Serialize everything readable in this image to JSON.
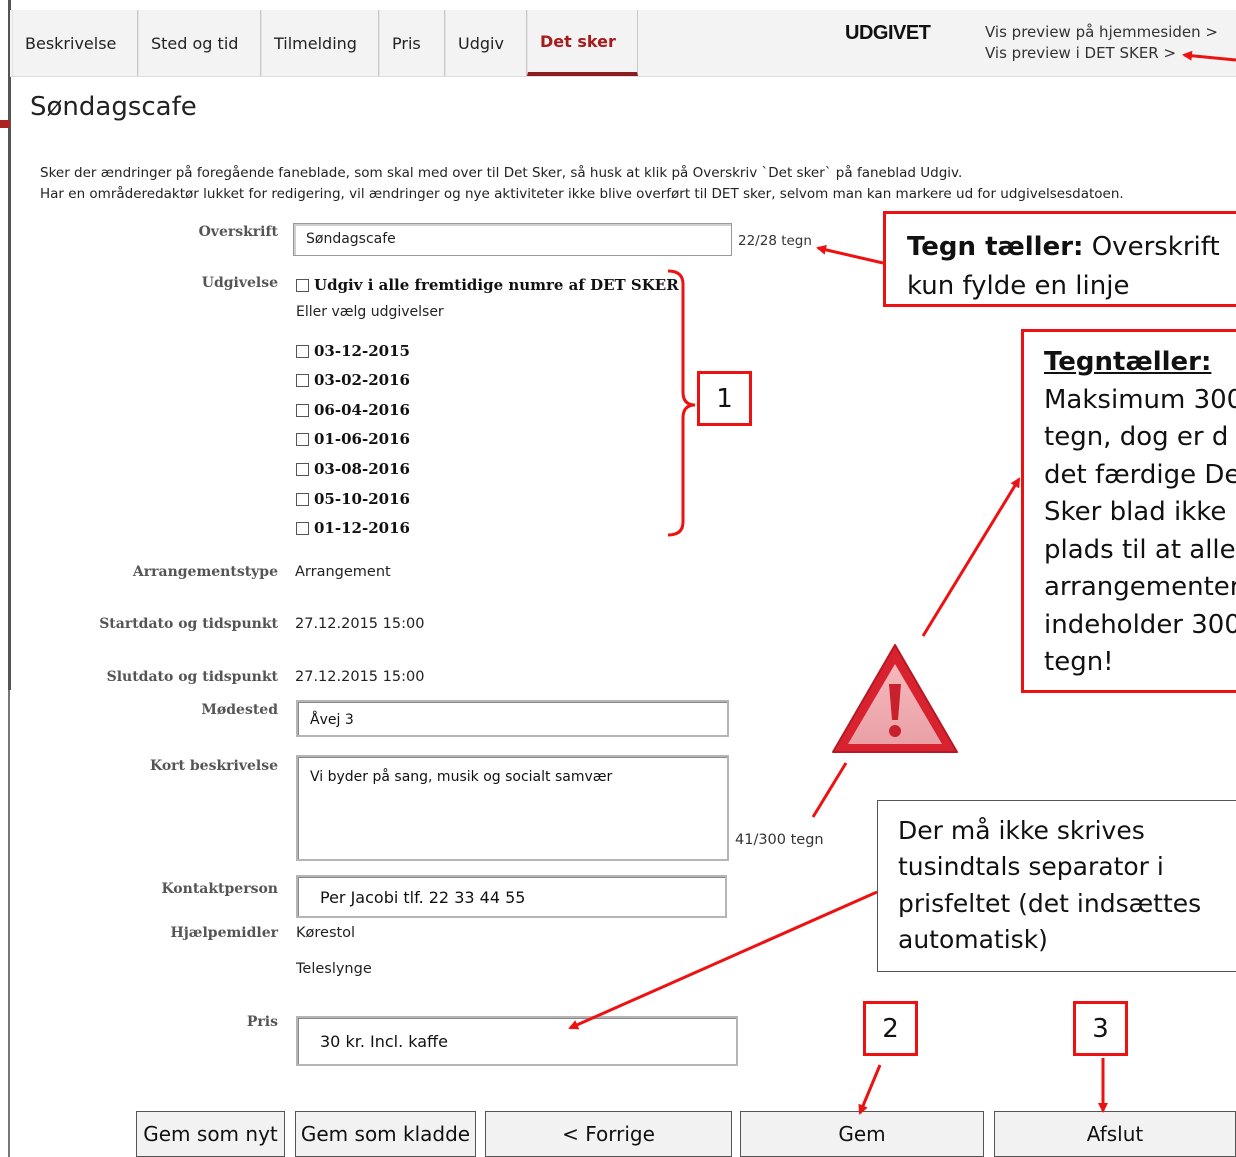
{
  "tabs": [
    "Beskrivelse",
    "Sted og tid",
    "Tilmelding",
    "Pris",
    "Udgiv",
    "Det sker"
  ],
  "active_tab": "Det sker",
  "status": "UDGIVET",
  "preview": {
    "homepage": "Vis preview på hjemmesiden >",
    "detsker": "Vis preview i DET SKER >"
  },
  "page_title": "Søndagscafe",
  "info": {
    "line1": "Sker der ændringer på foregående faneblade, som skal med over til Det Sker, så husk at klik på Overskriv `Det sker` på faneblad Udgiv.",
    "line2": "Har en områderedaktør lukket for redigering, vil ændringer og nye aktiviteter ikke blive overført til DET sker, selvom man kan markere ud for udgivelsesdatoen."
  },
  "form": {
    "overskrift_label": "Overskrift",
    "overskrift_value": "Søndagscafe",
    "overskrift_counter": "22/28 tegn",
    "udgivelse_label": "Udgivelse",
    "udgiv_alle": "Udgiv i alle fremtidige numre af DET SKER",
    "eller_vaelg": "Eller vælg udgivelser",
    "dates": [
      "03-12-2015",
      "03-02-2016",
      "06-04-2016",
      "01-06-2016",
      "03-08-2016",
      "05-10-2016",
      "01-12-2016"
    ],
    "arrangementstype_label": "Arrangementstype",
    "arrangementstype_value": "Arrangement",
    "start_label": "Startdato og tidspunkt",
    "start_value": "27.12.2015 15:00",
    "slut_label": "Slutdato og tidspunkt",
    "slut_value": "27.12.2015 15:00",
    "modested_label": "Mødested",
    "modested_value": "Åvej 3",
    "kort_label": "Kort beskrivelse",
    "kort_value": "Vi byder på sang, musik og socialt samvær",
    "kort_counter": "41/300 tegn",
    "kontakt_label": "Kontaktperson",
    "kontakt_value": "Per Jacobi tlf. 22 33 44 55",
    "hjaelp_label": "Hjælpemidler",
    "hjaelp_values": [
      "Kørestol",
      "Teleslynge"
    ],
    "pris_label": "Pris",
    "pris_value": "30 kr. Incl. kaffe"
  },
  "buttons": {
    "gem_som_nyt": "Gem som nyt",
    "gem_som_kladde": "Gem som kladde",
    "forrige": "< Forrige",
    "gem": "Gem",
    "afslut": "Afslut"
  },
  "annotations": {
    "tegn_bold": "Tegn tæller:",
    "tegn_rest1": " Overskrift",
    "tegn_rest2": "kun fylde en linje",
    "tegntaeller_title": "Tegntæller:",
    "tegntaeller_lines": [
      "Maksimum 300",
      "tegn, dog er d",
      "det færdige De",
      "Sker blad ikke",
      "plads til at alle",
      "arrangementer",
      "indeholder 300",
      "tegn!"
    ],
    "separator_note": "Der må ikke skrives tusindtals separator i prisfeltet (det indsættes automatisk)",
    "num1": "1",
    "num2": "2",
    "num3": "3"
  },
  "colors": {
    "accent": "#a61b1b",
    "annotation_red": "#e11111"
  }
}
